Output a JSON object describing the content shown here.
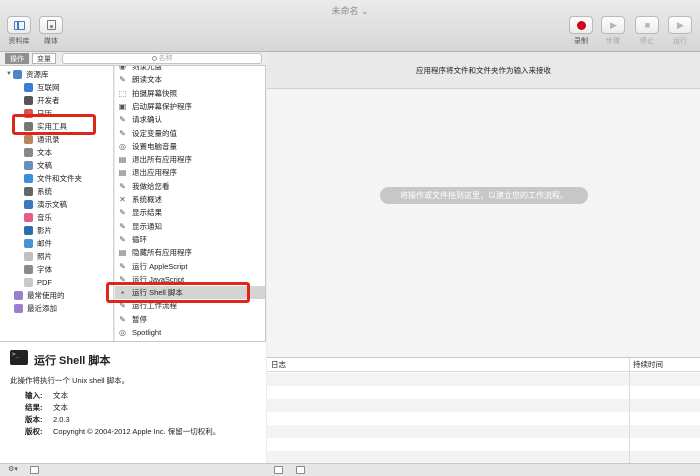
{
  "window": {
    "title": "未命名"
  },
  "toolbar": {
    "library": "资料库",
    "media": "媒体",
    "record": "录制",
    "step": "步骤",
    "stop": "停止",
    "run": "运行"
  },
  "tabs": {
    "actions": "操作",
    "variables": "变量"
  },
  "search": {
    "placeholder": "名称"
  },
  "categories": [
    {
      "label": "资源库",
      "icon": "library-icon",
      "color": "#4a86c8"
    },
    {
      "label": "互联网",
      "icon": "globe-icon",
      "color": "#3d7dd8"
    },
    {
      "label": "开发者",
      "icon": "developer-icon",
      "color": "#555555"
    },
    {
      "label": "日历",
      "icon": "calendar-icon",
      "color": "#d9534f"
    },
    {
      "label": "实用工具",
      "icon": "utilities-icon",
      "color": "#777777"
    },
    {
      "label": "通讯录",
      "icon": "contacts-icon",
      "color": "#b8865a"
    },
    {
      "label": "文本",
      "icon": "text-icon",
      "color": "#888888"
    },
    {
      "label": "文稿",
      "icon": "document-icon",
      "color": "#6c8ebf"
    },
    {
      "label": "文件和文件夹",
      "icon": "finder-icon",
      "color": "#3b8fd9"
    },
    {
      "label": "系统",
      "icon": "system-icon",
      "color": "#666666"
    },
    {
      "label": "演示文稿",
      "icon": "keynote-icon",
      "color": "#3a78c2"
    },
    {
      "label": "音乐",
      "icon": "music-icon",
      "color": "#e45b8a"
    },
    {
      "label": "影片",
      "icon": "movie-icon",
      "color": "#2a6fb0"
    },
    {
      "label": "邮件",
      "icon": "mail-icon",
      "color": "#4b91d8"
    },
    {
      "label": "照片",
      "icon": "photos-icon",
      "color": "#c0c0c0"
    },
    {
      "label": "字体",
      "icon": "font-icon",
      "color": "#8a8a8a"
    },
    {
      "label": "PDF",
      "icon": "pdf-icon",
      "color": "#c9c9c9"
    },
    {
      "label": "最常使用的",
      "icon": "folder-icon",
      "color": "#9a7fd1"
    },
    {
      "label": "最近添加",
      "icon": "folder-icon",
      "color": "#9a7fd1"
    }
  ],
  "actions": [
    {
      "label": "刻录光盘"
    },
    {
      "label": "朗读文本"
    },
    {
      "label": "拍摄屏幕快照"
    },
    {
      "label": "启动屏幕保护程序"
    },
    {
      "label": "请求确认"
    },
    {
      "label": "设定变量的值"
    },
    {
      "label": "设置电脑音量"
    },
    {
      "label": "退出所有应用程序"
    },
    {
      "label": "退出应用程序"
    },
    {
      "label": "我做给您看"
    },
    {
      "label": "系统概述"
    },
    {
      "label": "显示结果"
    },
    {
      "label": "显示通知"
    },
    {
      "label": "循环"
    },
    {
      "label": "隐藏所有应用程序"
    },
    {
      "label": "运行 AppleScript"
    },
    {
      "label": "运行 JavaScript"
    },
    {
      "label": "运行 Shell 脚本"
    },
    {
      "label": "运行工作流程"
    },
    {
      "label": "暂停"
    },
    {
      "label": "Spotlight"
    }
  ],
  "description": {
    "title": "运行 Shell 脚本",
    "text": "此操作将执行一个 Unix shell 脚本。",
    "input_label": "输入:",
    "input_value": "文本",
    "result_label": "结果:",
    "result_value": "文本",
    "version_label": "版本:",
    "version_value": "2.0.3",
    "copyright_label": "版权:",
    "copyright_value": "Copyright © 2004-2012 Apple Inc. 保留一切权利。"
  },
  "workflow": {
    "header": "应用程序将文件和文件夹作为输入来接收",
    "placeholder": "将操作或文件拖到这里，以建立您的工作流程。"
  },
  "log": {
    "col_log": "日志",
    "col_duration": "持续时间"
  }
}
